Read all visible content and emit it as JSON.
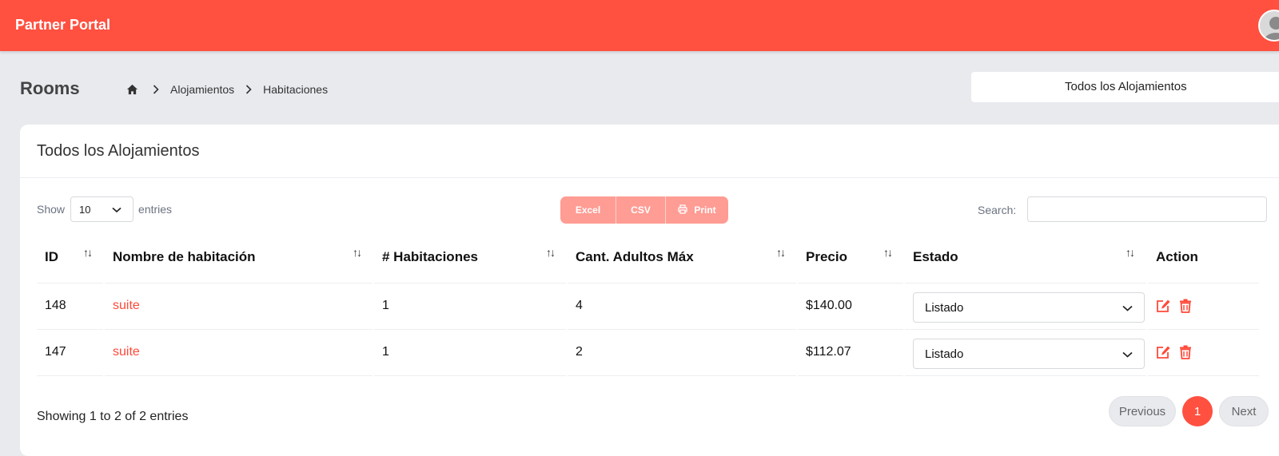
{
  "header": {
    "brand": "Partner Portal",
    "avatar_icon": "user-avatar-icon"
  },
  "page": {
    "title": "Rooms",
    "breadcrumb": [
      "Alojamientos",
      "Habitaciones"
    ],
    "property_select": "Todos los Alojamientos"
  },
  "card": {
    "title": "Todos los Alojamientos",
    "show_label": "Show",
    "entries_label": "entries",
    "page_length": "10",
    "export_buttons": [
      "Excel",
      "CSV",
      "Print"
    ],
    "search_label": "Search:",
    "search_value": ""
  },
  "table": {
    "columns": [
      "ID",
      "Nombre de habitación",
      "# Habitaciones",
      "Cant. Adultos Máx",
      "Precio",
      "Estado",
      "Action"
    ],
    "rows": [
      {
        "id": "148",
        "name": "suite",
        "rooms": "1",
        "max_adults": "4",
        "price": "$140.00",
        "status": "Listado"
      },
      {
        "id": "147",
        "name": "suite",
        "rooms": "1",
        "max_adults": "2",
        "price": "$112.07",
        "status": "Listado"
      }
    ]
  },
  "footer": {
    "info": "Showing 1 to 2 of 2 entries",
    "previous": "Previous",
    "current_page": "1",
    "next": "Next"
  },
  "colors": {
    "accent": "#ff5040",
    "export_button": "#ff9c94",
    "link": "#ff4a3a"
  }
}
